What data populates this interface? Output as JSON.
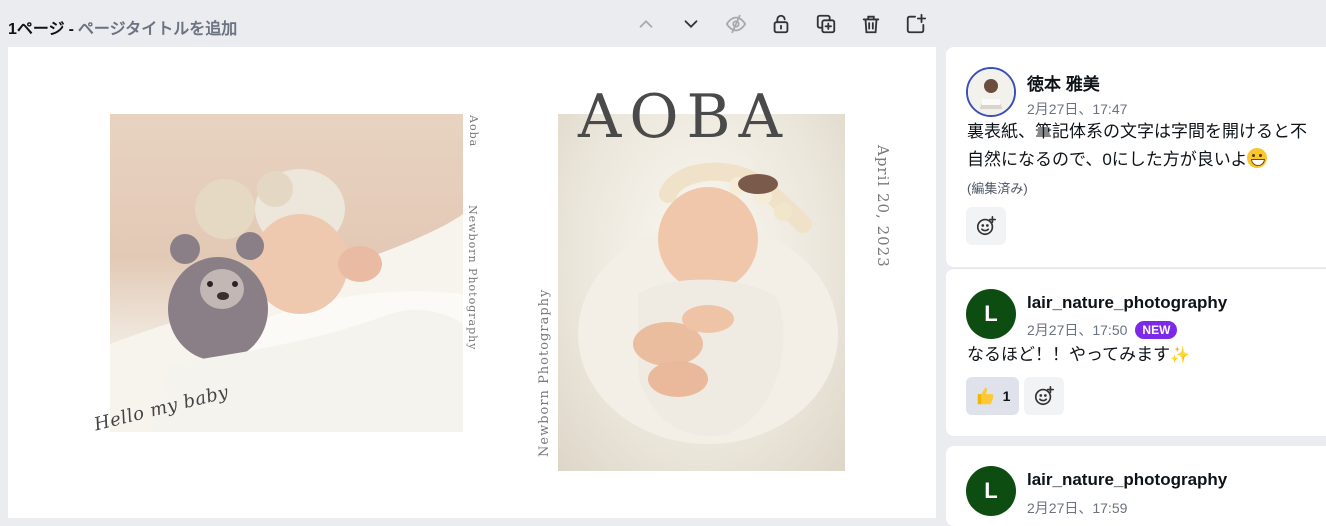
{
  "page_header": {
    "page_number": "1ページ",
    "separator": "-",
    "title_placeholder": "ページタイトルを追加"
  },
  "toolbar_icons": [
    "chevron-up-icon",
    "chevron-down-icon",
    "eye-off-icon",
    "lock-icon",
    "duplicate-icon",
    "trash-icon",
    "add-page-icon"
  ],
  "canvas": {
    "headline": "AOBA",
    "left_vertical_top": "Aoba",
    "left_vertical_bottom": "Newborn Photography",
    "right_vertical_left": "Newborn Photography",
    "date": "April 20, 2023",
    "script_text": "Hello my baby"
  },
  "comments": [
    {
      "author": "徳本 雅美",
      "timestamp": "2月27日、17:47",
      "text": "裏表紙、筆記体系の文字は字間を開けると不自然になるので、0にした方が良いよ",
      "text_emoji": "grinning-face",
      "edited": "(編集済み)"
    },
    {
      "author": "lair_nature_photography",
      "avatar_letter": "L",
      "timestamp": "2月27日、17:50",
      "badge": "NEW",
      "text": "なるほど！！やってみます",
      "text_emoji": "sparkles",
      "reaction_count": "1"
    },
    {
      "author": "lair_nature_photography",
      "avatar_letter": "L",
      "timestamp": "2月27日、17:59"
    }
  ],
  "colors": {
    "badge": "#7d2ae8",
    "avatar_green": "#0d4d12",
    "avatar_ring": "#3b4fb8",
    "workspace_bg": "#ebecf0"
  }
}
